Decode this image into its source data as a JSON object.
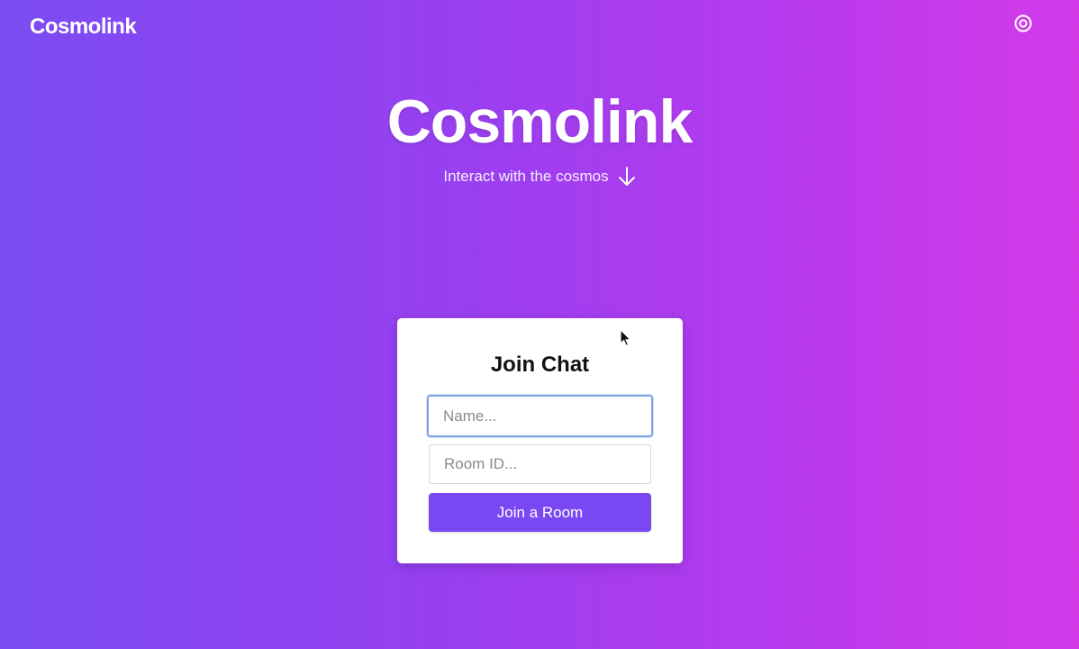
{
  "header": {
    "brand": "Cosmolink",
    "settings_icon": "settings-icon"
  },
  "hero": {
    "title": "Cosmolink",
    "subtitle": "Interact with the cosmos",
    "arrow_icon": "arrow-down-icon"
  },
  "join_card": {
    "title": "Join Chat",
    "name_placeholder": "Name...",
    "name_value": "",
    "room_placeholder": "Room ID...",
    "room_value": "",
    "join_button_label": "Join a Room"
  },
  "colors": {
    "gradient_start": "#7b4cf2",
    "gradient_end": "#d33be9",
    "button": "#7a48f3",
    "focus_ring": "#7ba4e0"
  }
}
